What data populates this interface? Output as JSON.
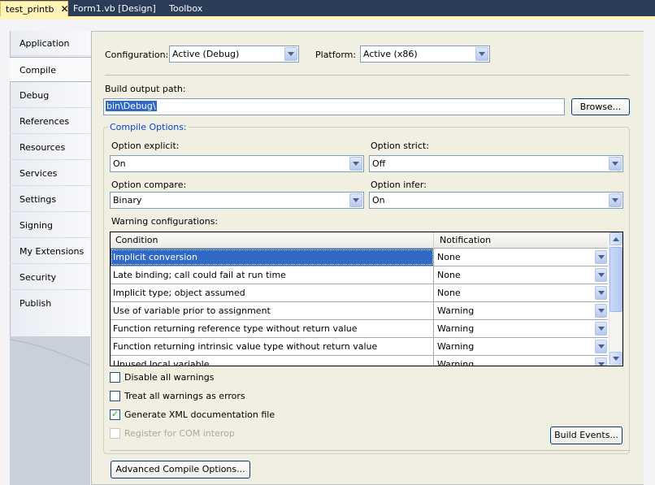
{
  "tabs": [
    {
      "label": "test_printb",
      "close": "✕"
    },
    {
      "label": "Form1.vb [Design]"
    },
    {
      "label": "Toolbox"
    }
  ],
  "sidebar": {
    "items": [
      {
        "label": "Application"
      },
      {
        "label": "Compile"
      },
      {
        "label": "Debug"
      },
      {
        "label": "References"
      },
      {
        "label": "Resources"
      },
      {
        "label": "Services"
      },
      {
        "label": "Settings"
      },
      {
        "label": "Signing"
      },
      {
        "label": "My Extensions"
      },
      {
        "label": "Security"
      },
      {
        "label": "Publish"
      }
    ],
    "selected": "Compile"
  },
  "config": {
    "configuration_label": "Configuration:",
    "configuration_value": "Active (Debug)",
    "platform_label": "Platform:",
    "platform_value": "Active (x86)"
  },
  "build": {
    "output_label": "Build output path:",
    "output_value": "bin\\Debug\\",
    "browse_label": "Browse..."
  },
  "compile_options": {
    "title": "Compile Options:",
    "explicit_label": "Option explicit:",
    "explicit_value": "On",
    "strict_label": "Option strict:",
    "strict_value": "Off",
    "compare_label": "Option compare:",
    "compare_value": "Binary",
    "infer_label": "Option infer:",
    "infer_value": "On",
    "warnings_label": "Warning configurations:"
  },
  "grid": {
    "headers": [
      "Condition",
      "Notification"
    ],
    "rows": [
      {
        "condition": "Implicit conversion",
        "notification": "None"
      },
      {
        "condition": "Late binding; call could fail at run time",
        "notification": "None"
      },
      {
        "condition": "Implicit type; object assumed",
        "notification": "None"
      },
      {
        "condition": "Use of variable prior to assignment",
        "notification": "Warning"
      },
      {
        "condition": "Function returning reference type without return value",
        "notification": "Warning"
      },
      {
        "condition": "Function returning intrinsic value type without return value",
        "notification": "Warning"
      },
      {
        "condition": "Unused local variable",
        "notification": "Warning"
      }
    ]
  },
  "checks": {
    "disable_all": {
      "label": "Disable all warnings",
      "checked": false
    },
    "treat_errors": {
      "label": "Treat all warnings as errors",
      "checked": false
    },
    "gen_xml": {
      "label": "Generate XML documentation file",
      "checked": true
    },
    "com_interop": {
      "label": "Register for COM interop",
      "checked": false
    }
  },
  "buttons": {
    "build_events": "Build Events...",
    "advanced": "Advanced Compile Options..."
  },
  "colors": {
    "tab_strip": "#2b3c59",
    "active_tab": "#fff4b8",
    "selection": "#316ac5",
    "panel": "#f1efe2",
    "group_title": "#0046d5"
  }
}
